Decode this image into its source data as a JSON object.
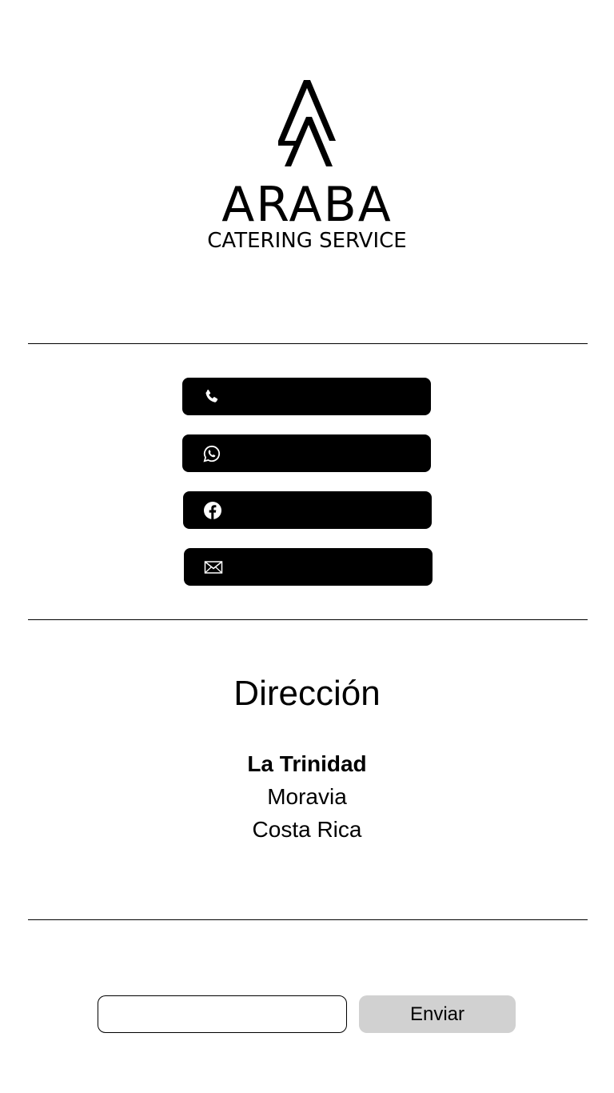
{
  "brand": {
    "name": "ARABA",
    "subtitle": "CATERING SERVICE"
  },
  "contacts": [
    {
      "icon": "phone-icon",
      "label": ""
    },
    {
      "icon": "whatsapp-icon",
      "label": ""
    },
    {
      "icon": "facebook-icon",
      "label": ""
    },
    {
      "icon": "mail-icon",
      "label": ""
    }
  ],
  "address": {
    "title": "Dirección",
    "line1": "La Trinidad",
    "line2": "Moravia",
    "line3": "Costa Rica"
  },
  "subscribe": {
    "input_value": "",
    "input_placeholder": "",
    "button_label": "Enviar"
  },
  "colors": {
    "background": "#ffffff",
    "button_dark": "#000000",
    "button_light": "#d1d1d1"
  }
}
